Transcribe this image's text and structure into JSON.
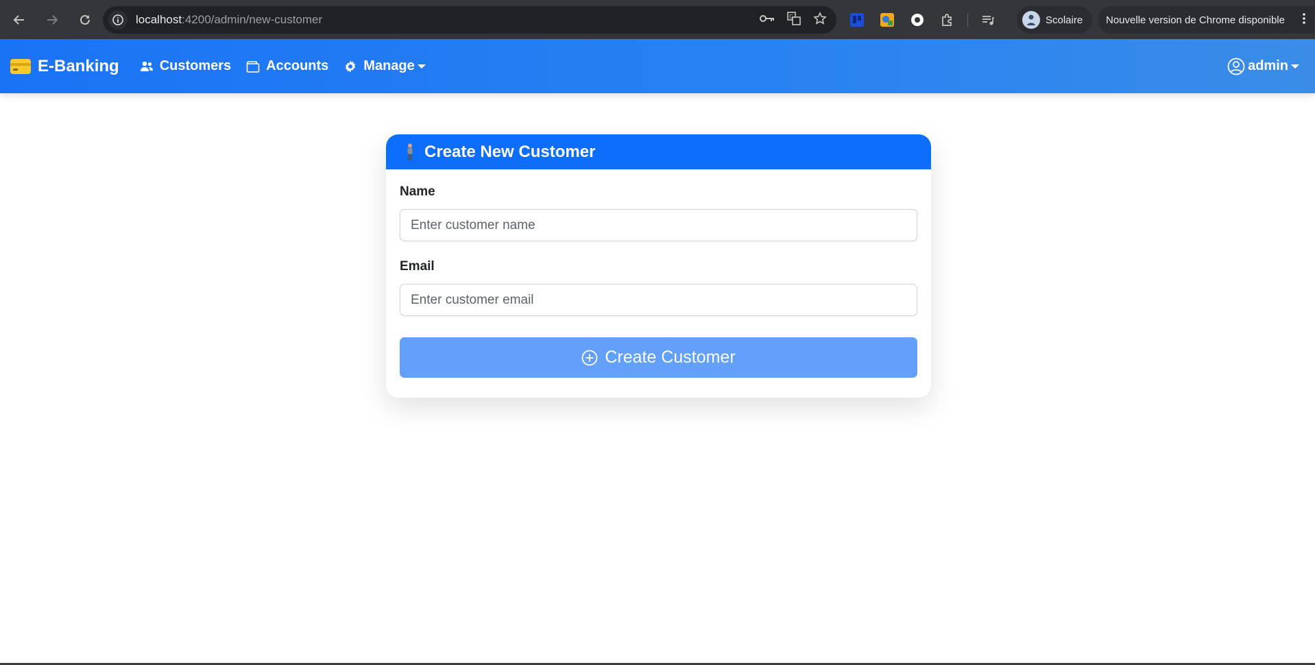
{
  "browser": {
    "url_host": "localhost",
    "url_path": ":4200/admin/new-customer",
    "profile_name": "Scolaire",
    "update_text": "Nouvelle version de Chrome disponible"
  },
  "navbar": {
    "brand": "E-Banking",
    "links": [
      {
        "label": "Customers"
      },
      {
        "label": "Accounts"
      },
      {
        "label": "Manage"
      }
    ],
    "user": "admin"
  },
  "form": {
    "title": "Create New Customer",
    "name_label": "Name",
    "name_placeholder": "Enter customer name",
    "name_value": "",
    "email_label": "Email",
    "email_placeholder": "Enter customer email",
    "email_value": "",
    "submit_label": "Create Customer"
  },
  "colors": {
    "navbar": "#1a73f5",
    "card_header": "#0d6efd",
    "submit_disabled": "#62a0fb",
    "brand_icon": "#f7c92c"
  }
}
